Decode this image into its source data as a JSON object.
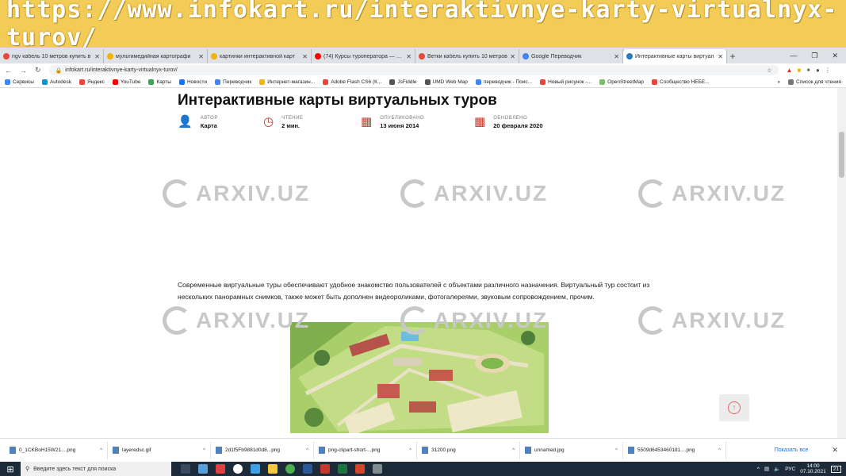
{
  "banner": {
    "url": "https://www.infokart.ru/interaktivnye-karty-virtualnyx-turov/"
  },
  "tabs": [
    {
      "title": "ngv кабель 10 метров купить в",
      "color": "#e8453c",
      "active": false
    },
    {
      "title": "мультимедийная картографи",
      "color": "#f4b400",
      "active": false
    },
    {
      "title": "картинки интерактивной карт",
      "color": "#f4b400",
      "active": false
    },
    {
      "title": "(74) Курсы туроператора — Rich",
      "color": "#ff0000",
      "active": false
    },
    {
      "title": "Ветки кабель купить 10 метров",
      "color": "#e8453c",
      "active": false
    },
    {
      "title": "Google Переводчик",
      "color": "#4285f4",
      "active": false
    },
    {
      "title": "Интерактивные карты виртуал",
      "color": "#2b7bb9",
      "active": true
    }
  ],
  "toolbar": {
    "url": "infokart.ru/interaktivnye-karty-virtualnyx-turov/"
  },
  "bookmarks": [
    {
      "label": "Сервисы",
      "color": "#4285f4"
    },
    {
      "label": "Autodesk",
      "color": "#0696d7"
    },
    {
      "label": "Яндекс",
      "color": "#e8453c"
    },
    {
      "label": "YouTube",
      "color": "#ff0000"
    },
    {
      "label": "Карты",
      "color": "#34a853"
    },
    {
      "label": "Новости",
      "color": "#1a73e8"
    },
    {
      "label": "Переводчик",
      "color": "#4285f4"
    },
    {
      "label": "Интернет-магазин...",
      "color": "#f4b400"
    },
    {
      "label": "Adobe Flash CS6 (К...",
      "color": "#e8453c"
    },
    {
      "label": "JsFiddle",
      "color": "#555555"
    },
    {
      "label": "UMD Web Map",
      "color": "#555555"
    },
    {
      "label": "переводчик - Поис...",
      "color": "#4285f4"
    },
    {
      "label": "Новый рисунок -...",
      "color": "#e8453c"
    },
    {
      "label": "OpenStreetMap",
      "color": "#7ebc6f"
    },
    {
      "label": "Сообщество НЕБЕ...",
      "color": "#e8453c"
    }
  ],
  "bookmarks_more": "»",
  "bookmarks_other": "Список для чтения",
  "article": {
    "title": "Интерактивные карты виртуальных туров",
    "meta": [
      {
        "icon": "user-icon",
        "label": "АВТОР",
        "value": "Карта"
      },
      {
        "icon": "clock-icon",
        "label": "ЧТЕНИЕ",
        "value": "2 мин."
      },
      {
        "icon": "calendar-icon",
        "label": "ОПУБЛИКОВАНО",
        "value": "13 июня 2014"
      },
      {
        "icon": "calendar-icon",
        "label": "ОБНОВЛЕНО",
        "value": "20 февраля 2020"
      }
    ],
    "paragraph": "Современные виртуальные туры обеспечивают удобное знакомство пользователей с объектами различного назначения. Виртуальный тур состоит из нескольких панорамных снимков, также может быть дополнен видеороликами, фотогалереями, звуковым сопровождением, прочим."
  },
  "watermark": "ARXIV.UZ",
  "downloads": [
    "0_1CKBoH15W21....png",
    "layeredsc.gif",
    "2d1f5Fb9881d0d8...png",
    "png-clipart-short-...png",
    "31200.png",
    "unnamed.jpg",
    "5509d6453460181....png"
  ],
  "downloads_show_all": "Показать все",
  "taskbar": {
    "search_placeholder": "Введите здесь текст для поиска",
    "lang": "РУС",
    "time": "14:00",
    "date": "07.10.2021",
    "notif": "21"
  }
}
